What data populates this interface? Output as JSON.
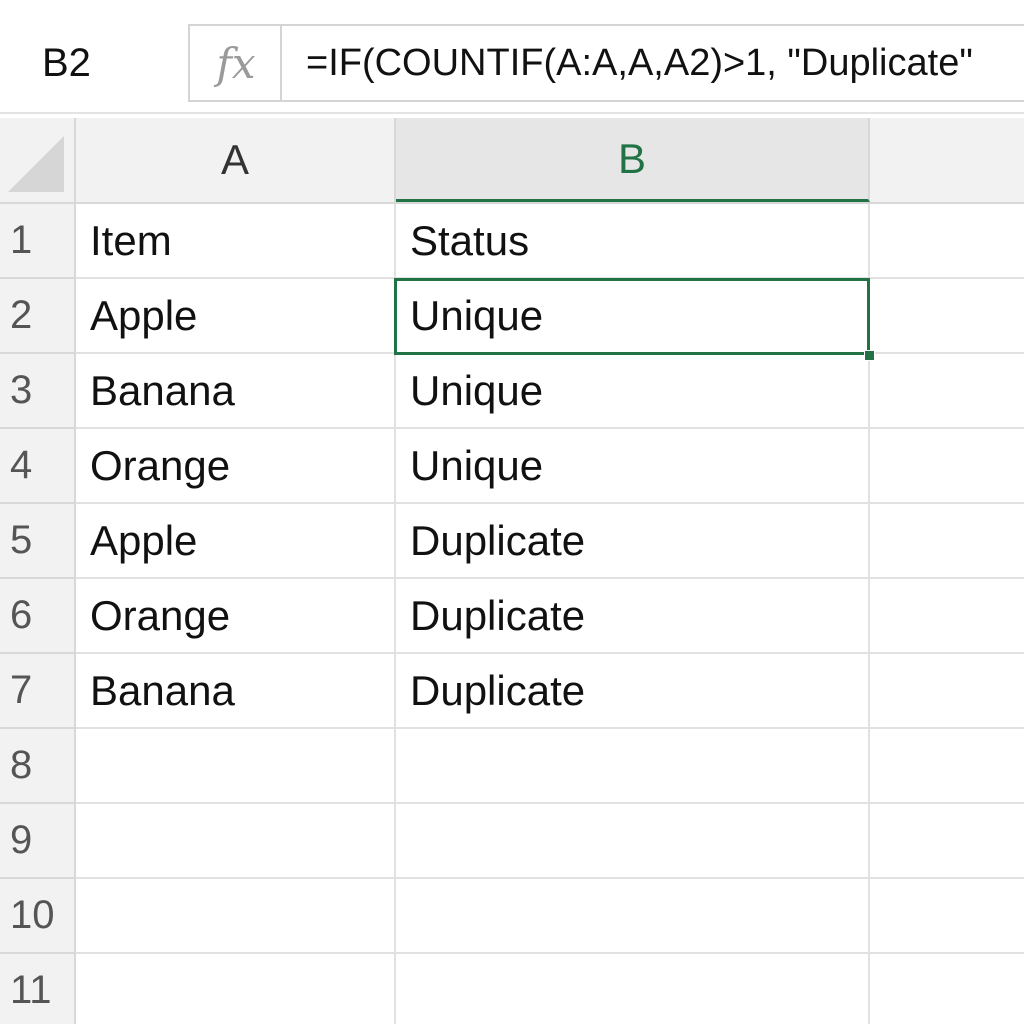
{
  "formula_bar": {
    "name_box": "B2",
    "fx_icon": "fx",
    "formula": "=IF(COUNTIF(A:A,A,A2)>1, \"Duplicate\""
  },
  "columns": [
    {
      "label": "A",
      "active": false
    },
    {
      "label": "B",
      "active": true
    }
  ],
  "selected_cell": "B2",
  "colors": {
    "accent": "#217346",
    "header_bg": "#f2f2f2",
    "gridline": "#e1e1e1"
  },
  "rows": [
    {
      "num": "1",
      "a": "Item",
      "b": "Status"
    },
    {
      "num": "2",
      "a": "Apple",
      "b": "Unique"
    },
    {
      "num": "3",
      "a": "Banana",
      "b": "Unique"
    },
    {
      "num": "4",
      "a": "Orange",
      "b": "Unique"
    },
    {
      "num": "5",
      "a": "Apple",
      "b": "Duplicate"
    },
    {
      "num": "6",
      "a": "Orange",
      "b": "Duplicate"
    },
    {
      "num": "7",
      "a": "Banana",
      "b": "Duplicate"
    },
    {
      "num": "8",
      "a": "",
      "b": ""
    },
    {
      "num": "9",
      "a": "",
      "b": ""
    },
    {
      "num": "10",
      "a": "",
      "b": ""
    },
    {
      "num": "11",
      "a": "",
      "b": ""
    }
  ]
}
